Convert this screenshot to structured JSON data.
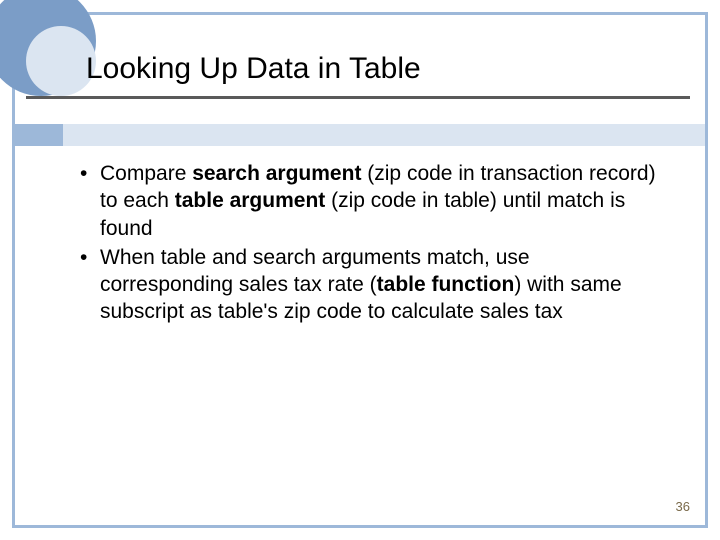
{
  "title": "Looking Up Data in Table",
  "bullets": [
    {
      "pre1": "Compare ",
      "b1": "search argument",
      "mid1": " (zip code in transaction record) to each ",
      "b2": "table argument",
      "post1": " (zip code in table) until match is found"
    },
    {
      "pre1": "When table and search arguments match, use corresponding sales tax rate (",
      "b1": "table function",
      "post1": ") with same subscript as table's zip code to calculate sales tax"
    }
  ],
  "page_number": "36"
}
